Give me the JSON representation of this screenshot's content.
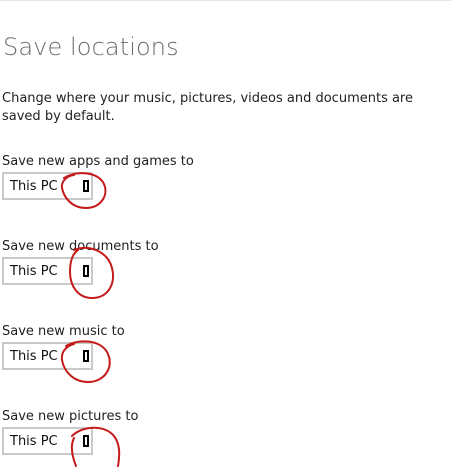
{
  "page": {
    "title": "Save locations",
    "description": "Change where your music, pictures, videos and documents are saved by default."
  },
  "settings": [
    {
      "label": "Save new apps and games to",
      "value": "This PC"
    },
    {
      "label": "Save new documents to",
      "value": "This PC"
    },
    {
      "label": "Save new music to",
      "value": "This PC"
    },
    {
      "label": "Save new pictures to",
      "value": "This PC"
    }
  ],
  "colors": {
    "title": "#6b6b6b",
    "dropdown_border": "#c9c9c9",
    "annotation": "#c41a1a"
  },
  "icons": {
    "dropdown_chevron": "missing-glyph-box-icon"
  }
}
